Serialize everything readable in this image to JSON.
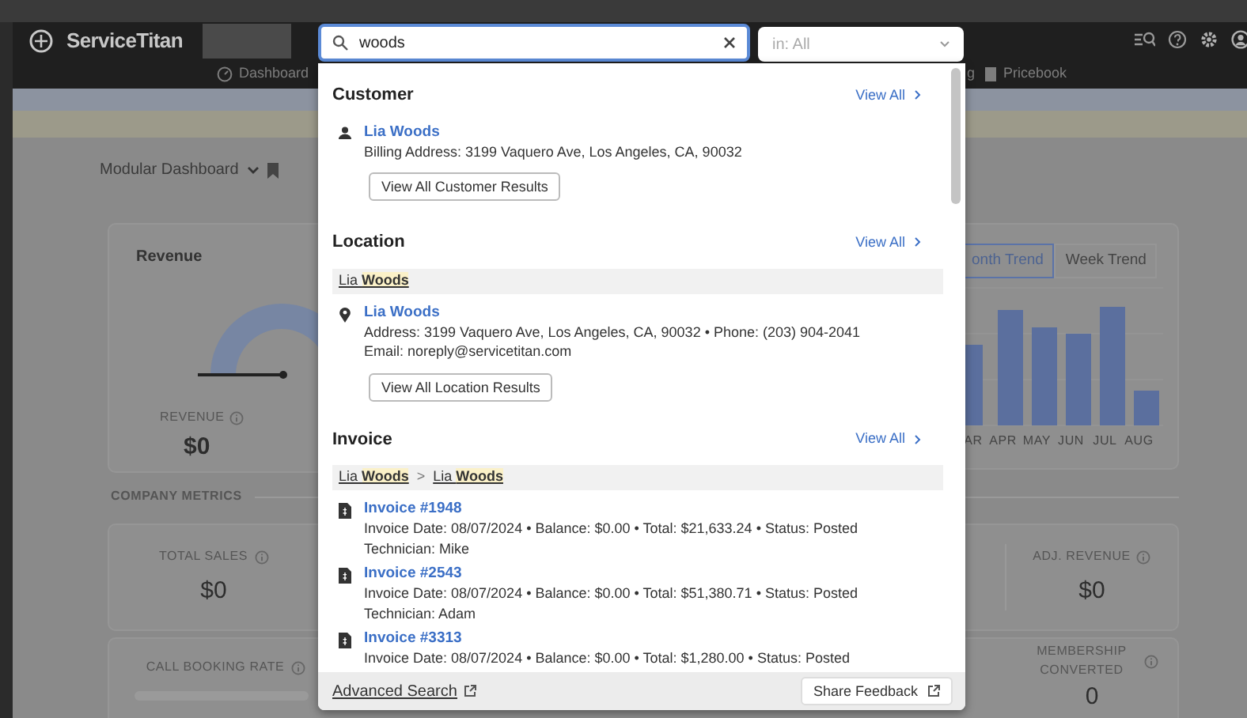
{
  "header": {
    "logo": "ServiceTitan",
    "search": {
      "value": "woods"
    },
    "scope": {
      "value": "in: All"
    },
    "nav": [
      {
        "kind": "dashboard",
        "label": "Dashboard"
      },
      {
        "kind": "plain",
        "label": "g"
      },
      {
        "kind": "pricebook",
        "label": "Pricebook"
      }
    ]
  },
  "dashboard": {
    "view": "Modular Dashboard",
    "revenue_card": {
      "title": "Revenue",
      "label": "REVENUE",
      "value": "$0"
    },
    "trend_tabs": [
      {
        "label": "onth Trend",
        "selected": true
      },
      {
        "label": "Week Trend",
        "selected": false
      }
    ],
    "months": [
      "AR",
      "APR",
      "MAY",
      "JUN",
      "JUL",
      "AUG"
    ],
    "section": "COMPANY METRICS",
    "metrics": [
      {
        "kind": "value",
        "label": "TOTAL SALES",
        "value": "$0"
      },
      {
        "kind": "value",
        "label": "ADJ. REVENUE",
        "value": "$0"
      },
      {
        "kind": "bar",
        "label": "CALL BOOKING RATE",
        "level": 0
      },
      {
        "kind": "value",
        "label": "MEMBERSHIP CONVERTED",
        "value": "0"
      }
    ]
  },
  "results": {
    "sections": [
      {
        "kind": "customer",
        "title": "Customer",
        "view_all": "View All",
        "items": [
          {
            "name": "Lia Woods",
            "lines": [
              "Billing Address: 3199 Vaquero Ave, Los Angeles, CA, 90032"
            ]
          }
        ],
        "button": "View All Customer Results"
      },
      {
        "kind": "location",
        "title": "Location",
        "view_all": "View All",
        "breadcrumb": [
          "Lia **Woods**"
        ],
        "items": [
          {
            "name": "Lia Woods",
            "lines": [
              "Address: 3199 Vaquero Ave, Los Angeles, CA, 90032 • Phone: (203) 904-2041",
              "Email: noreply@servicetitan.com"
            ]
          }
        ],
        "button": "View All Location Results"
      },
      {
        "kind": "invoice",
        "title": "Invoice",
        "view_all": "View All",
        "breadcrumb": [
          "Lia **Woods**",
          "Lia **Woods**"
        ],
        "separator": ">",
        "items": [
          {
            "name": "Invoice #1948",
            "lines": [
              "Invoice Date: 08/07/2024 • Balance: $0.00 • Total: $21,633.24 • Status: Posted",
              "Technician: Mike"
            ]
          },
          {
            "name": "Invoice #2543",
            "lines": [
              "Invoice Date: 08/07/2024 • Balance: $0.00 • Total: $51,380.71 • Status: Posted",
              "Technician: Adam"
            ]
          },
          {
            "name": "Invoice #3313",
            "lines": [
              "Invoice Date: 08/07/2024 • Balance: $0.00 • Total: $1,280.00 • Status: Posted"
            ]
          }
        ]
      }
    ],
    "footer": {
      "link": "Advanced Search",
      "button": "Share Feedback"
    }
  }
}
